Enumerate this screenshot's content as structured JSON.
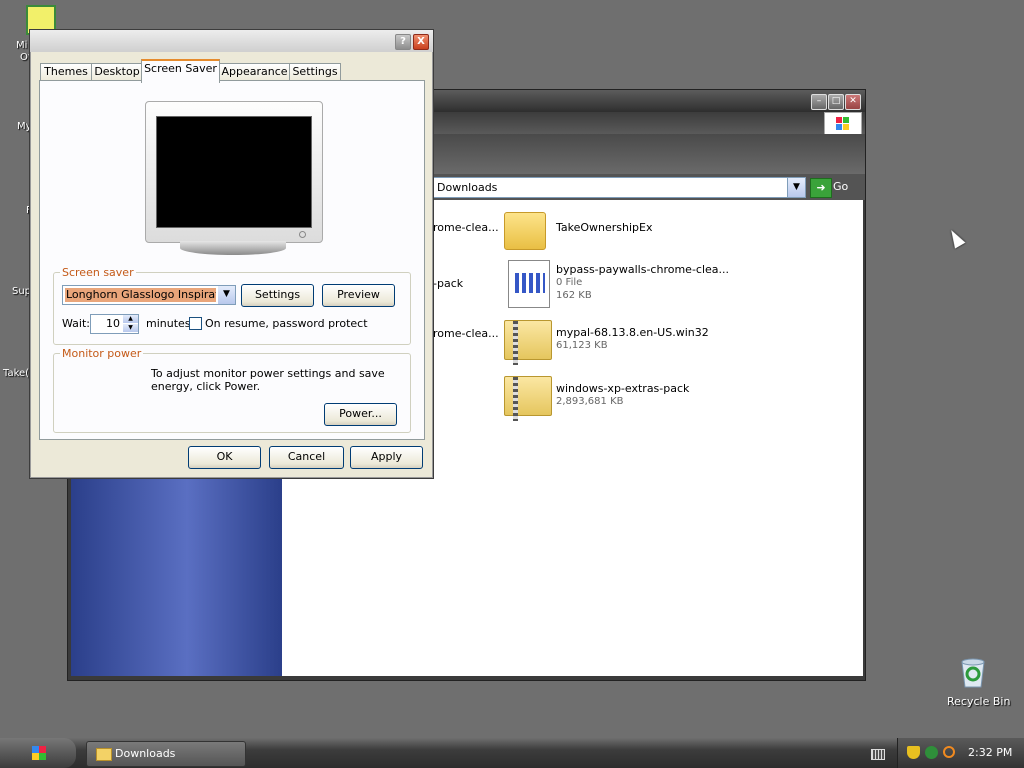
{
  "desktop": {
    "icons_clipped": [
      "Mi",
      "Of",
      "My",
      "F",
      "Sup",
      "Take("
    ],
    "recycle_bin": "Recycle Bin"
  },
  "explorer": {
    "address": "Downloads",
    "go_label": "Go",
    "partial_left_labels": [
      "rome-clea...",
      "-pack",
      "rome-clea..."
    ],
    "items": [
      {
        "name": "TakeOwnershipEx",
        "type": "folder"
      },
      {
        "name": "bypass-paywalls-chrome-clea...",
        "line2": "0 File",
        "line3": "162 KB",
        "type": "file"
      },
      {
        "name": "mypal-68.13.8.en-US.win32",
        "line2": "61,123 KB",
        "type": "zip"
      },
      {
        "name": "windows-xp-extras-pack",
        "line2": "2,893,681 KB",
        "type": "zip"
      }
    ]
  },
  "dialog": {
    "help": "?",
    "close": "X",
    "tabs": [
      "Themes",
      "Desktop",
      "Screen Saver",
      "Appearance",
      "Settings"
    ],
    "active_tab": "Screen Saver",
    "screen_saver": {
      "group_title": "Screen saver",
      "selected": "Longhorn Glasslogo Inspirat",
      "settings_label": "Settings",
      "preview_label": "Preview",
      "wait_label": "Wait:",
      "wait_value": "10",
      "minutes_label": "minutes",
      "password_label": "On resume, password protect",
      "password_checked": false
    },
    "monitor_power": {
      "group_title": "Monitor power",
      "description": "To adjust monitor power settings and save energy, click Power.",
      "power_label": "Power..."
    },
    "ok_label": "OK",
    "cancel_label": "Cancel",
    "apply_label": "Apply"
  },
  "taskbar": {
    "task_label": "Downloads",
    "clock": "2:32 PM"
  }
}
